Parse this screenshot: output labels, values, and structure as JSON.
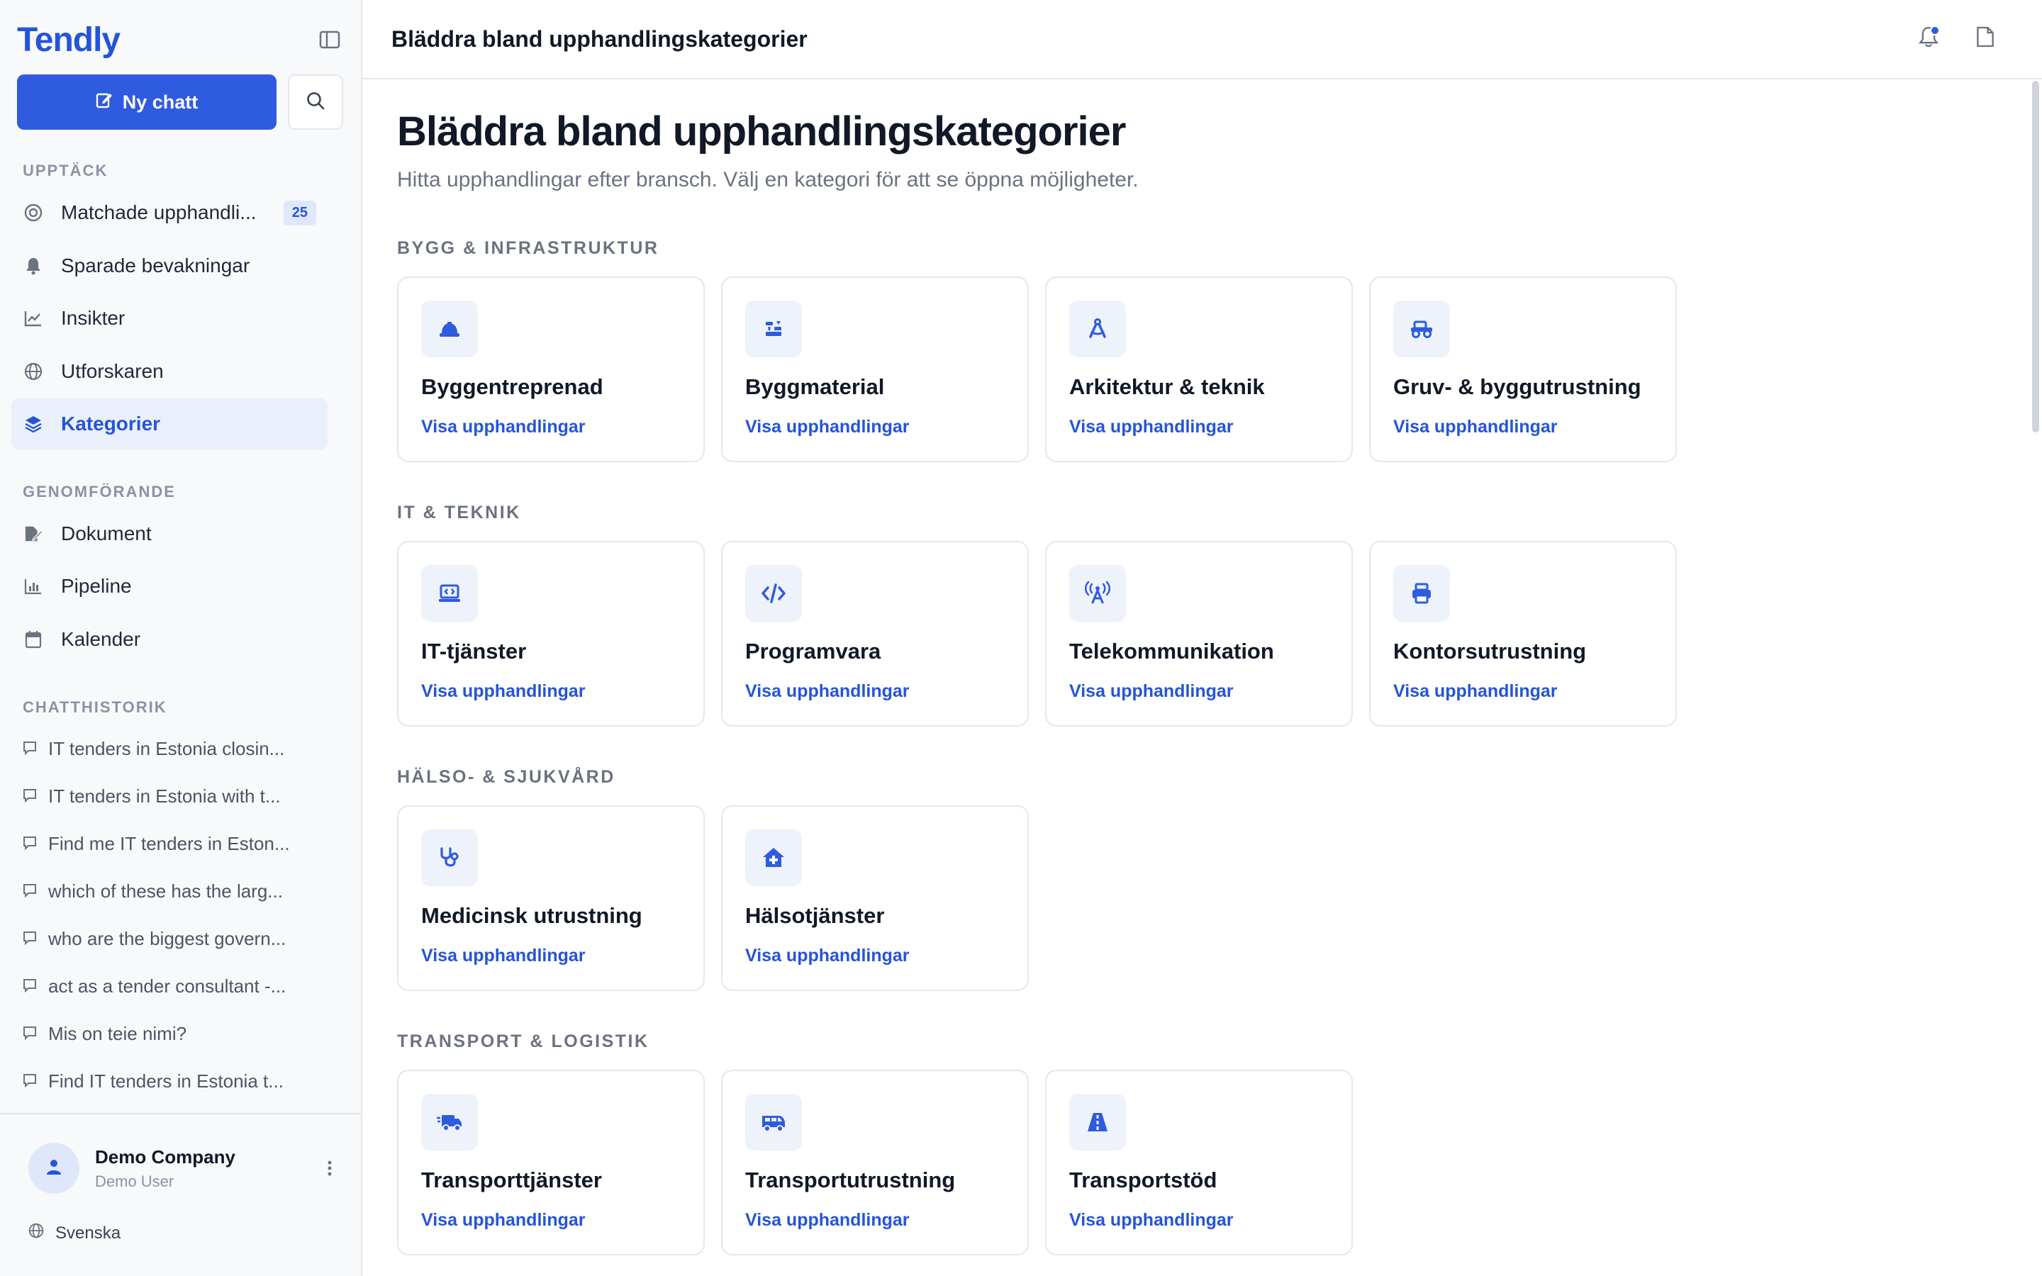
{
  "sidebar": {
    "brand": "Tendly",
    "new_chat_label": "Ny chatt",
    "sections": {
      "discover": "UPPTÄCK",
      "execution": "GENOMFÖRANDE",
      "chat_history": "CHATTHISTORIK"
    },
    "discover_items": [
      {
        "label": "Matchade upphandli...",
        "icon": "target-icon",
        "badge": "25"
      },
      {
        "label": "Sparade bevakningar",
        "icon": "bell-icon"
      },
      {
        "label": "Insikter",
        "icon": "line-chart-icon"
      },
      {
        "label": "Utforskaren",
        "icon": "globe-icon"
      },
      {
        "label": "Kategorier",
        "icon": "layers-icon",
        "active": true
      }
    ],
    "execution_items": [
      {
        "label": "Dokument",
        "icon": "document-edit-icon"
      },
      {
        "label": "Pipeline",
        "icon": "bar-chart-icon"
      },
      {
        "label": "Kalender",
        "icon": "calendar-icon"
      }
    ],
    "chats": [
      "IT tenders in Estonia closin...",
      "IT tenders in Estonia with t...",
      "Find me IT tenders in Eston...",
      "which of these has the larg...",
      "who are the biggest govern...",
      "act as a tender consultant -...",
      "Mis on teie nimi?",
      "Find IT tenders in Estonia t..."
    ],
    "user": {
      "name": "Demo Company",
      "role": "Demo User"
    },
    "language": "Svenska"
  },
  "topbar": {
    "title": "Bläddra bland upphandlingskategorier"
  },
  "page": {
    "title": "Bläddra bland upphandlingskategorier",
    "subtitle": "Hitta upphandlingar efter bransch. Välj en kategori för att se öppna möjligheter."
  },
  "link_label": "Visa upphandlingar",
  "categories": [
    {
      "label": "BYGG & INFRASTRUKTUR",
      "cards": [
        {
          "title": "Byggentreprenad",
          "icon": "hard-hat-icon"
        },
        {
          "title": "Byggmaterial",
          "icon": "building-materials-icon"
        },
        {
          "title": "Arkitektur & teknik",
          "icon": "compass-drafting-icon"
        },
        {
          "title": "Gruv- & byggutrustning",
          "icon": "heavy-vehicle-icon"
        }
      ]
    },
    {
      "label": "IT & TEKNIK",
      "cards": [
        {
          "title": "IT-tjänster",
          "icon": "laptop-code-icon"
        },
        {
          "title": "Programvara",
          "icon": "code-icon"
        },
        {
          "title": "Telekommunikation",
          "icon": "tower-broadcast-icon"
        },
        {
          "title": "Kontorsutrustning",
          "icon": "printer-icon"
        }
      ]
    },
    {
      "label": "HÄLSO- & SJUKVÅRD",
      "cards": [
        {
          "title": "Medicinsk utrustning",
          "icon": "stethoscope-icon"
        },
        {
          "title": "Hälsotjänster",
          "icon": "house-medical-icon"
        }
      ]
    },
    {
      "label": "TRANSPORT & LOGISTIK",
      "cards": [
        {
          "title": "Transporttjänster",
          "icon": "truck-fast-icon"
        },
        {
          "title": "Transportutrustning",
          "icon": "van-shuttle-icon"
        },
        {
          "title": "Transportstöd",
          "icon": "road-icon"
        }
      ]
    }
  ],
  "colors": {
    "accent": "#2f5be0",
    "link": "#2554d8",
    "icon_bg": "#eef2fb"
  }
}
